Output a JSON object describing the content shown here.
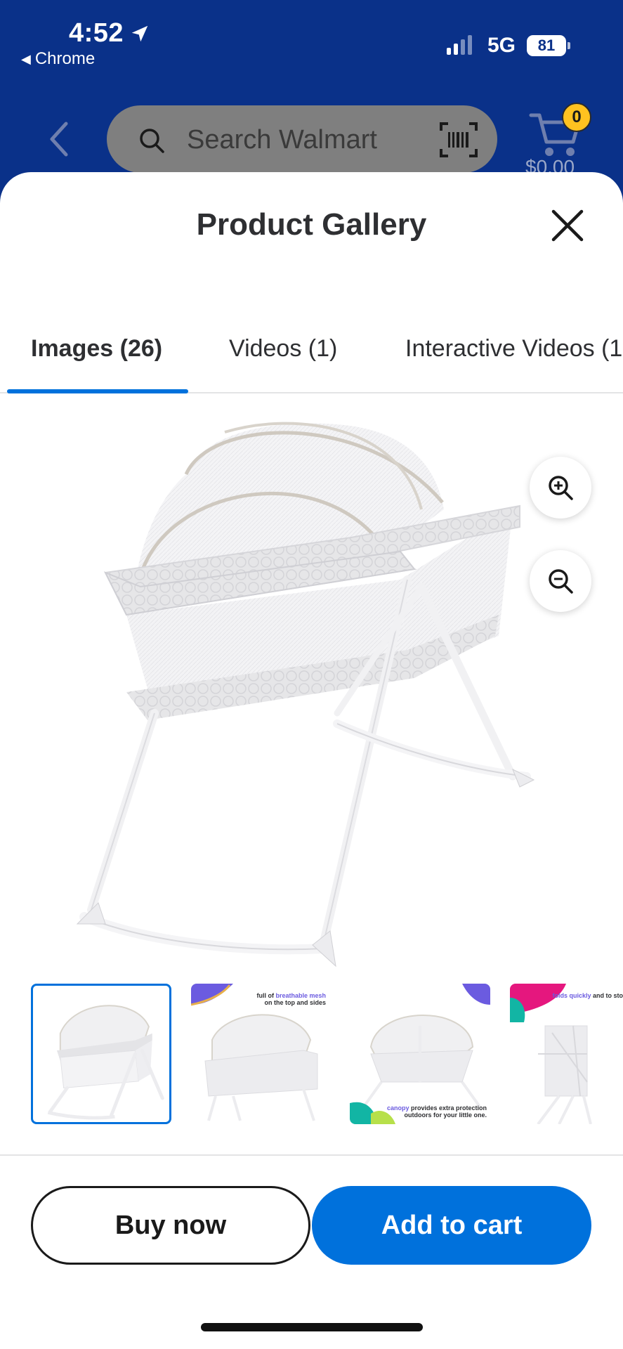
{
  "status_bar": {
    "time": "4:52",
    "back_app": "Chrome",
    "network": "5G",
    "battery": "81"
  },
  "walmart_header": {
    "search_placeholder": "Search Walmart",
    "cart_count": "0",
    "cart_total": "$0.00"
  },
  "gallery": {
    "title": "Product Gallery",
    "tabs": [
      {
        "label": "Images (26)",
        "active": true
      },
      {
        "label": "Videos (1)",
        "active": false
      },
      {
        "label": "Interactive Videos (1",
        "active": false
      }
    ],
    "thumbnails": [
      {
        "caption_plain": "",
        "caption_highlight": ""
      },
      {
        "caption_pre": "full of ",
        "caption_highlight": "breathable mesh",
        "caption_post": "on the top and sides"
      },
      {
        "caption_highlight": "canopy",
        "caption_post": " provides extra protection outdoors for your little one."
      },
      {
        "caption_highlight": "folds quickly",
        "caption_post": " and to stow or take on th"
      }
    ]
  },
  "actions": {
    "buy_now": "Buy now",
    "add_to_cart": "Add to cart"
  },
  "colors": {
    "walmart_blue": "#0a3189",
    "accent_blue": "#0071dc",
    "badge_yellow": "#ffc220"
  }
}
